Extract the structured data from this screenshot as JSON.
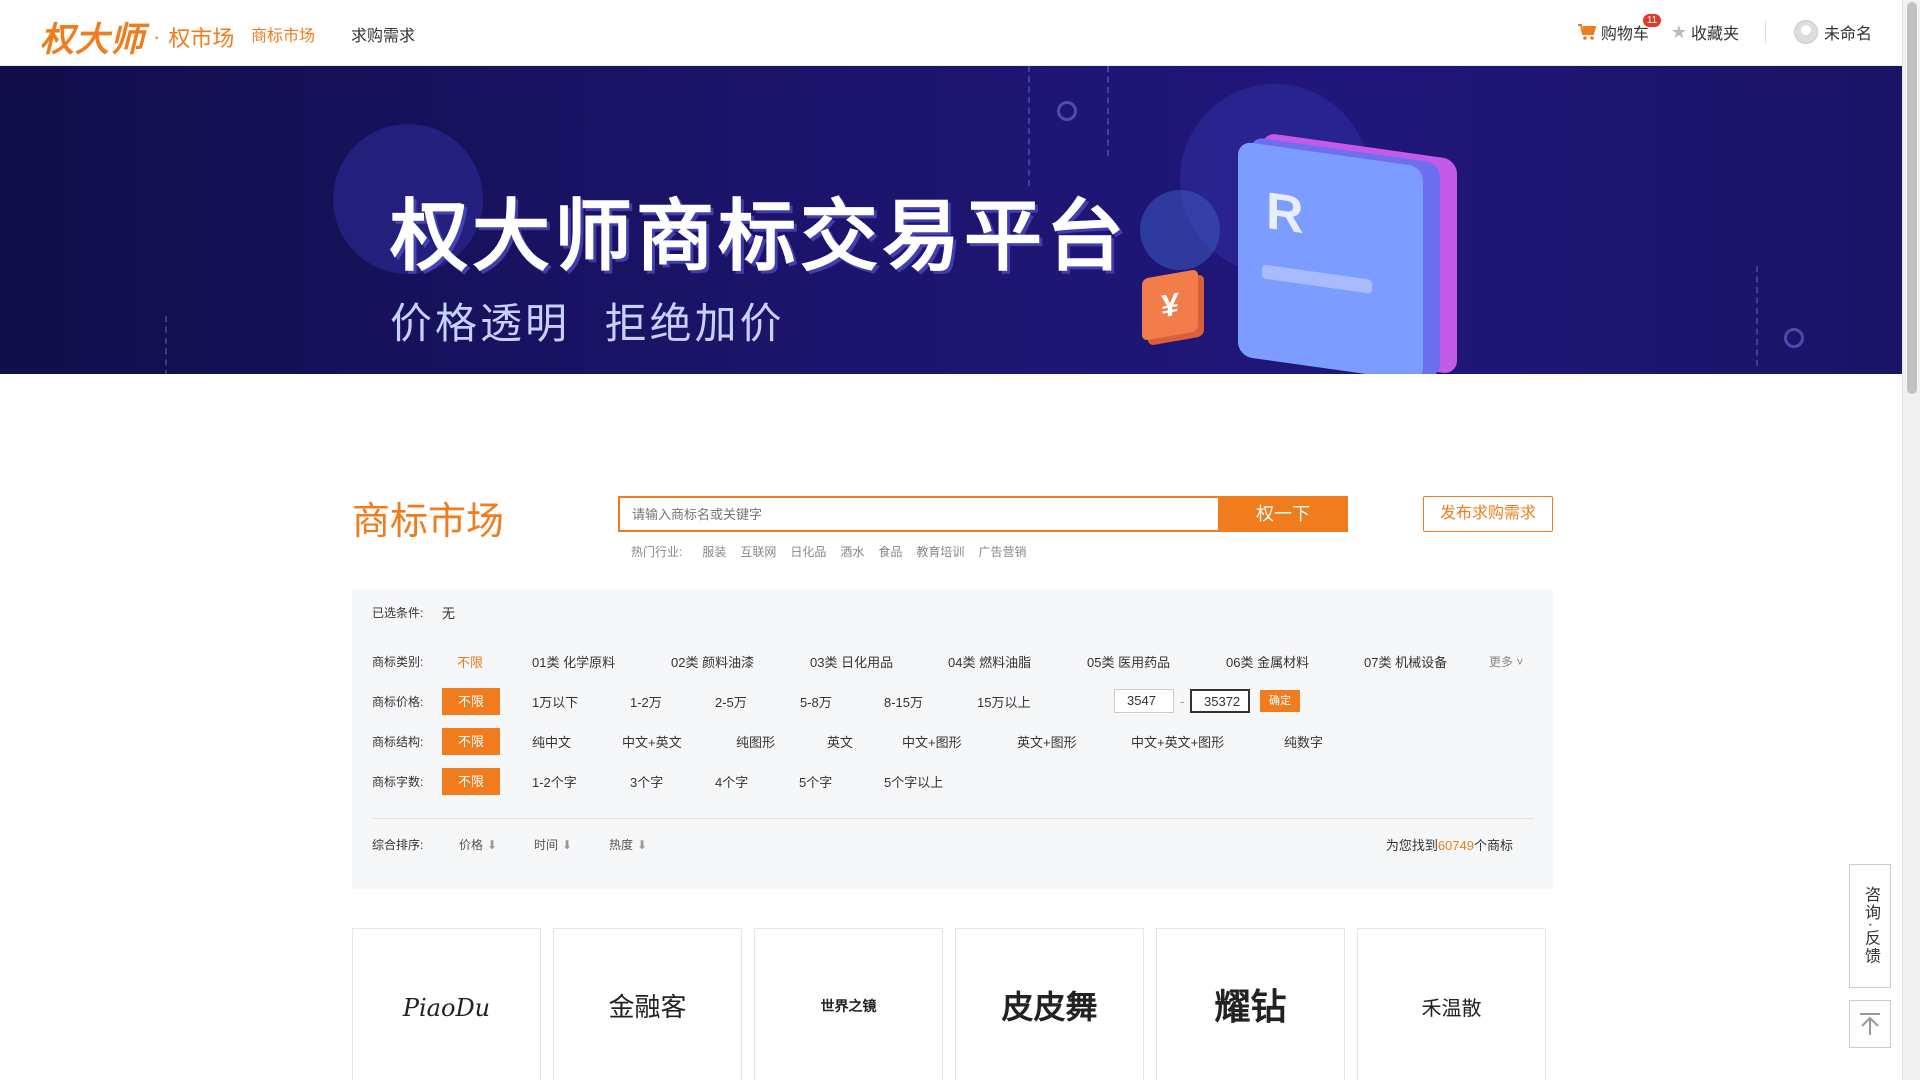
{
  "header": {
    "logo": "权大师",
    "logo_sub": "权市场",
    "nav": [
      "商标市场",
      "求购需求"
    ],
    "cart_label": "购物车",
    "cart_count": "11",
    "fav_label": "收藏夹",
    "user_label": "未命名"
  },
  "banner": {
    "title": "权大师商标交易平台",
    "subtitle": "价格透明 拒绝加价",
    "yen_glyph": "¥",
    "r_glyph": "R"
  },
  "market": {
    "title": "商标市场",
    "search_placeholder": "请输入商标名或关键字",
    "search_button": "权一下",
    "publish_button": "发布求购需求",
    "hot_label": "热门行业:",
    "hot_items": [
      "服装",
      "互联网",
      "日化品",
      "酒水",
      "食品",
      "教育培训",
      "广告营销"
    ]
  },
  "filter": {
    "selected_label": "已选条件:",
    "selected_value": "无",
    "category_label": "商标类别:",
    "categories": [
      "不限",
      "01类 化学原料",
      "02类 颜料油漆",
      "03类 日化用品",
      "04类 燃料油脂",
      "05类 医用药品",
      "06类 金属材料",
      "07类 机械设备"
    ],
    "more_label": "更多",
    "price_label": "商标价格:",
    "prices": [
      "不限",
      "1万以下",
      "1-2万",
      "2-5万",
      "5-8万",
      "8-15万",
      "15万以上"
    ],
    "price_min": "3547",
    "price_max": "35372",
    "price_dash": "-",
    "confirm_label": "确定",
    "structure_label": "商标结构:",
    "structures": [
      "不限",
      "纯中文",
      "中文+英文",
      "纯图形",
      "英文",
      "中文+图形",
      "英文+图形",
      "中文+英文+图形",
      "纯数字"
    ],
    "count_label": "商标字数:",
    "counts": [
      "不限",
      "1-2个字",
      "3个字",
      "4个字",
      "5个字",
      "5个字以上"
    ],
    "sort_label": "综合排序:",
    "sorts": [
      "价格",
      "时间",
      "热度"
    ],
    "found_prefix": "为您找到",
    "found_count": "60749",
    "found_suffix": "个商标"
  },
  "cards": [
    "PiaoDu",
    "金融客",
    "世界之镜",
    "皮皮舞",
    "耀钻",
    "禾温散"
  ],
  "float": {
    "consult": "咨询·反馈"
  },
  "colors": {
    "accent": "#f07c1e",
    "banner_bg": "#1b146a"
  }
}
